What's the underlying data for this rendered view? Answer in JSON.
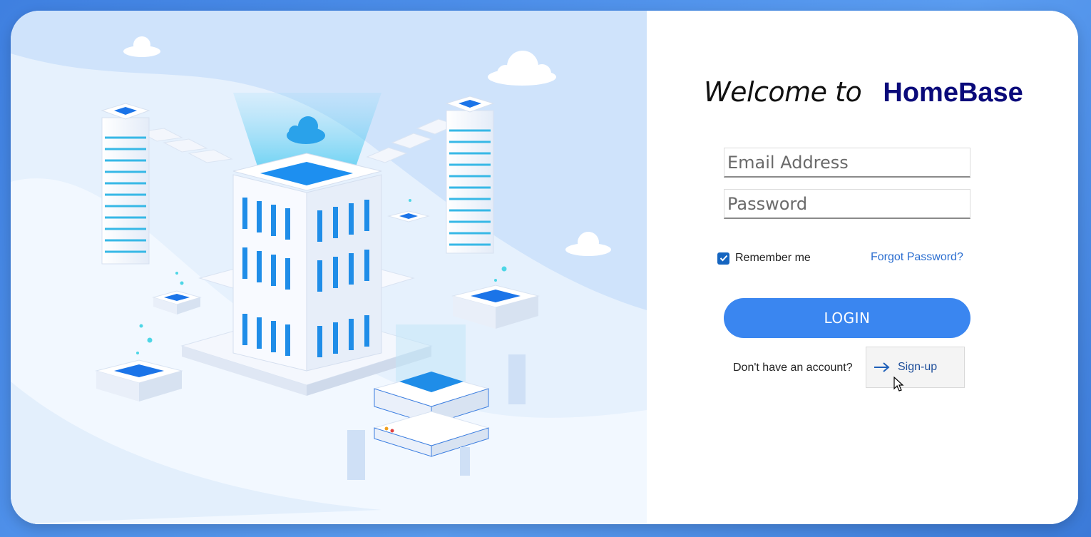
{
  "welcome": {
    "lead": "Welcome to",
    "brand": "HomeBase"
  },
  "form": {
    "email_placeholder": "Email Address",
    "email_value": "",
    "password_placeholder": "Password",
    "password_value": "",
    "remember_label": "Remember me",
    "remember_checked": true,
    "forgot_label": "Forgot Password?",
    "login_label": "LOGIN",
    "no_account_text": "Don't have an account?",
    "signup_label": "Sign-up"
  },
  "icons": {
    "checkbox": "check-icon",
    "signup": "arrow-right-icon",
    "hero_cloud": "cloud-icon",
    "pointer": "mouse-pointer-icon"
  },
  "colors": {
    "accent": "#3a86f0",
    "brand_text": "#0a0a7a",
    "link": "#2b6ed0",
    "checkbox": "#1565c0",
    "hero_bg": "#cfe3fb",
    "frame_bg": "#4f8fe8"
  }
}
